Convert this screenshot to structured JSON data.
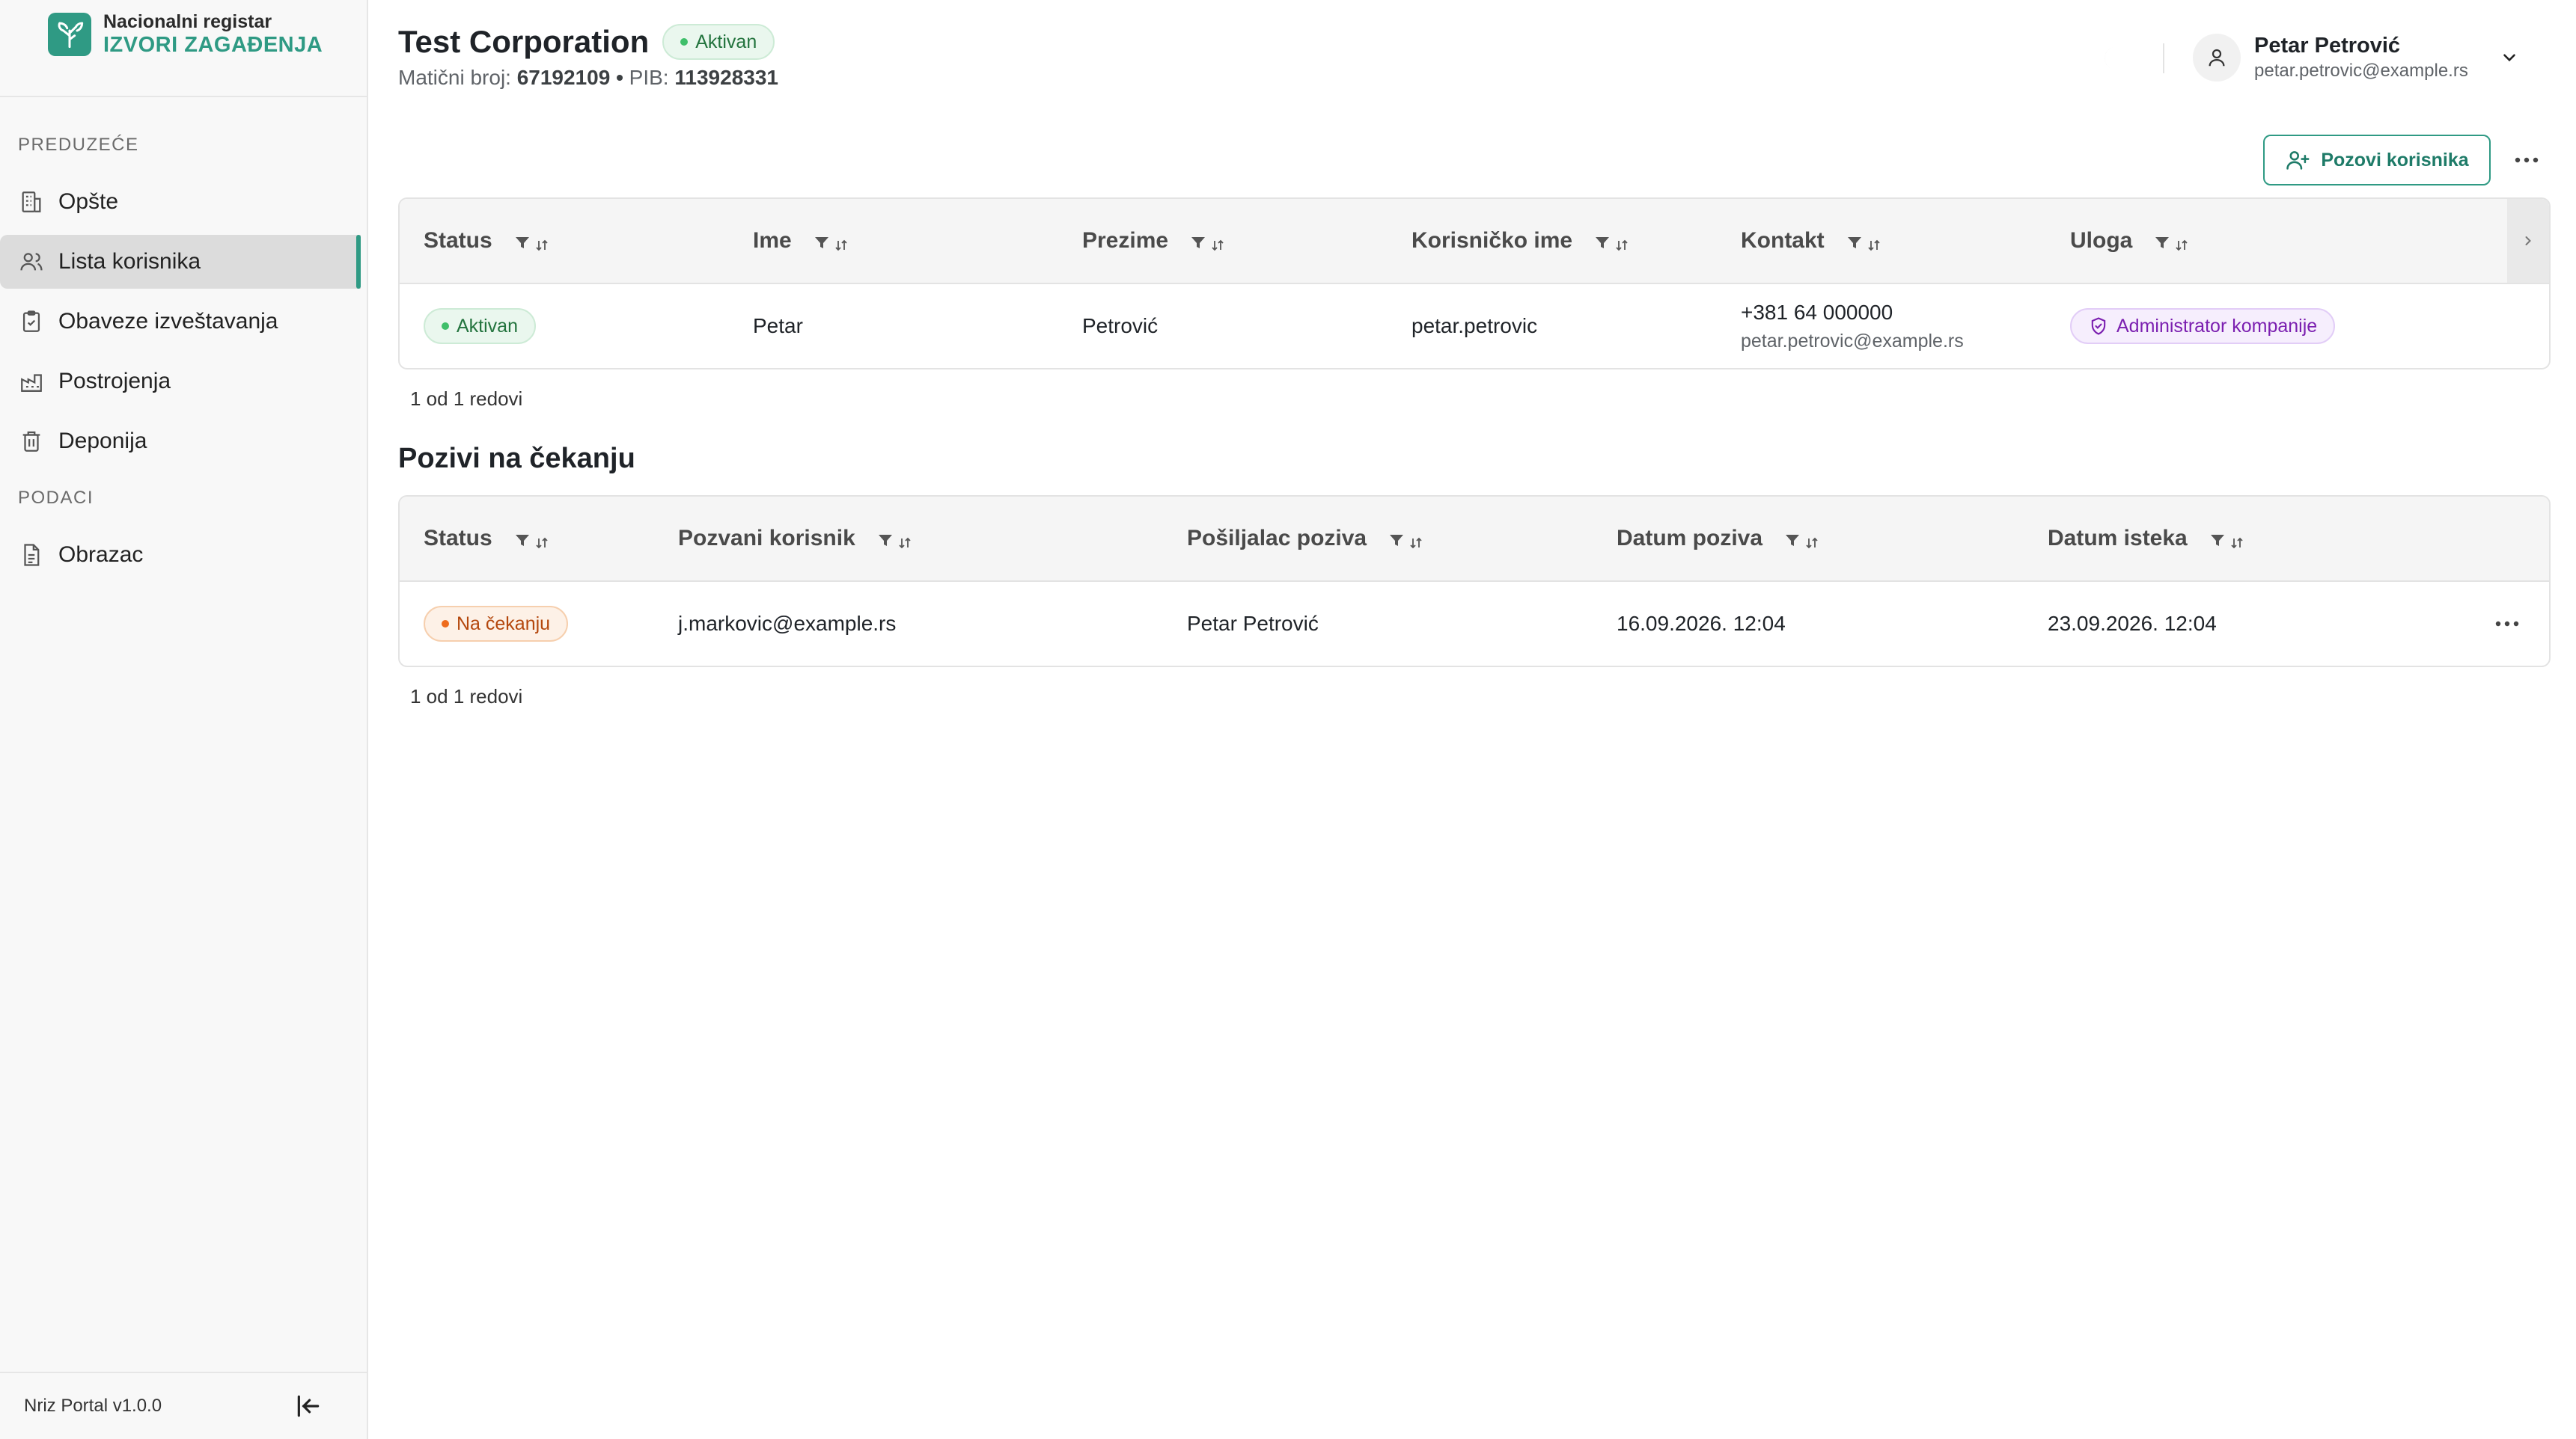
{
  "brand": {
    "line1": "Nacionalni registar",
    "line2": "IZVORI ZAGAĐENJA",
    "logo_icon": "leaf-icon",
    "color": "#2f9a84"
  },
  "sidebar": {
    "section_company": "PREDUZEĆE",
    "section_data": "PODACI",
    "items": [
      {
        "label": "Opšte",
        "icon": "building-icon"
      },
      {
        "label": "Lista korisnika",
        "icon": "users-icon",
        "active": true
      },
      {
        "label": "Obaveze izveštavanja",
        "icon": "clipboard-check-icon"
      },
      {
        "label": "Postrojenja",
        "icon": "factory-icon"
      },
      {
        "label": "Deponija",
        "icon": "trash-icon"
      },
      {
        "label": "Obrazac",
        "icon": "document-icon"
      }
    ],
    "version": "Nriz Portal v1.0.0"
  },
  "header": {
    "company_name": "Test Corporation",
    "status": "Aktivan",
    "maticni_label": "Matični broj:",
    "maticni_value": "67192109",
    "separator": "•",
    "pib_label": "PIB:",
    "pib_value": "113928331"
  },
  "user": {
    "name": "Petar Petrović",
    "email": "petar.petrovic@example.rs"
  },
  "actions": {
    "invite_label": "Pozovi korisnika"
  },
  "users_table": {
    "columns": [
      "Status",
      "Ime",
      "Prezime",
      "Korisničko ime",
      "Kontakt",
      "Uloga"
    ],
    "rows": [
      {
        "status": "Aktivan",
        "ime": "Petar",
        "prezime": "Petrović",
        "username": "petar.petrovic",
        "phone": "+381 64 000000",
        "email": "petar.petrovic@example.rs",
        "role": "Administrator kompanije"
      }
    ],
    "row_count": "1 od 1 redovi"
  },
  "invites": {
    "title": "Pozivi na čekanju",
    "columns": [
      "Status",
      "Pozvani korisnik",
      "Pošiljalac poziva",
      "Datum poziva",
      "Datum isteka"
    ],
    "rows": [
      {
        "status": "Na čekanju",
        "invitee": "j.markovic@example.rs",
        "sender": "Petar Petrović",
        "sent": "16.09.2026. 12:04",
        "expires": "23.09.2026. 12:04"
      }
    ],
    "row_count": "1 od 1 redovi"
  },
  "colors": {
    "accent": "#2f9a84",
    "active_green": "#3fbf6a",
    "pending_orange": "#ee6b1c",
    "role_purple": "#7b1fb0"
  }
}
